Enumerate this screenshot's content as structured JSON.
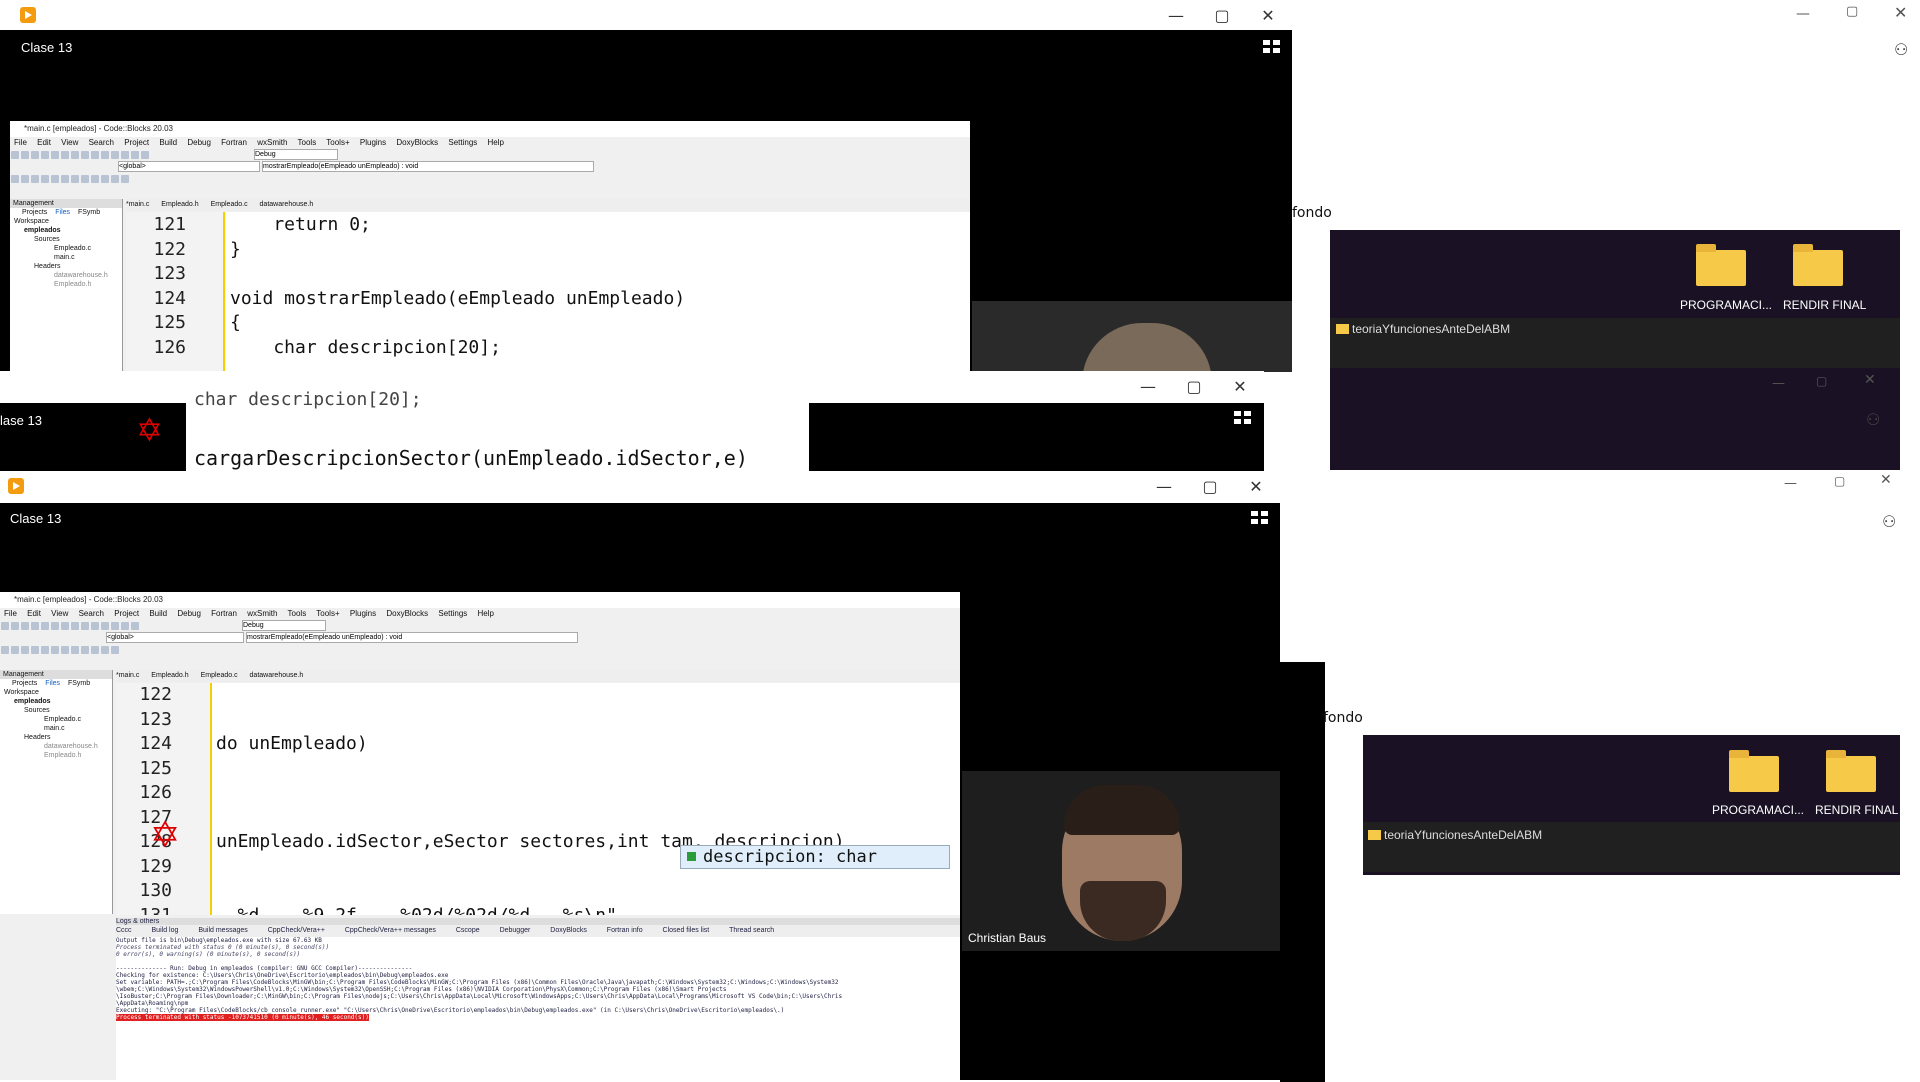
{
  "win1": {
    "title": "Clase 13"
  },
  "win2": {
    "title": "lase 13"
  },
  "win3": {
    "title": "Clase 13"
  },
  "codeblocks_top": {
    "title": "*main.c [empleados] - Code::Blocks 20.03",
    "menu": [
      "File",
      "Edit",
      "View",
      "Search",
      "Project",
      "Build",
      "Debug",
      "Fortran",
      "wxSmith",
      "Tools",
      "Tools+",
      "Plugins",
      "DoxyBlocks",
      "Settings",
      "Help"
    ],
    "build_target": "Debug",
    "scope": "<global>",
    "symbol": "mostrarEmpleado(eEmpleado unEmpleado) : void",
    "tabs": [
      "*main.c",
      "Empleado.h",
      "Empleado.c",
      "datawarehouse.h"
    ],
    "management": "Management",
    "mgmt_tabs": [
      "Projects",
      "Files",
      "FSymb"
    ],
    "tree": [
      "Workspace",
      "empleados",
      "Sources",
      "Empleado.c",
      "main.c",
      "Headers",
      "datawarehouse.h",
      "Empleado.h"
    ],
    "lines": [
      {
        "n": "121",
        "code": "    return 0;"
      },
      {
        "n": "122",
        "code": "}"
      },
      {
        "n": "123",
        "code": ""
      },
      {
        "n": "124",
        "code": "void mostrarEmpleado(eEmpleado unEmpleado)"
      },
      {
        "n": "125",
        "code": "{"
      },
      {
        "n": "126",
        "code": "    char descripcion[20];"
      }
    ]
  },
  "zoom_strip": {
    "top_text": "char descripcion[20];",
    "code_text": "cargarDescripcionSector(unEmpleado.idSector,e)"
  },
  "codeblocks_bottom": {
    "title": "*main.c [empleados] - Code::Blocks 20.03",
    "menu": [
      "File",
      "Edit",
      "View",
      "Search",
      "Project",
      "Build",
      "Debug",
      "Fortran",
      "wxSmith",
      "Tools",
      "Tools+",
      "Plugins",
      "DoxyBlocks",
      "Settings",
      "Help"
    ],
    "build_target": "Debug",
    "scope": "<global>",
    "symbol": "mostrarEmpleado(eEmpleado unEmpleado) : void",
    "tabs": [
      "*main.c",
      "Empleado.h",
      "Empleado.c",
      "datawarehouse.h"
    ],
    "management": "Management",
    "mgmt_tabs": [
      "Projects",
      "Files",
      "FSymb"
    ],
    "tree": [
      "Workspace",
      "empleados",
      "Sources",
      "Empleado.c",
      "main.c",
      "Headers",
      "datawarehouse.h",
      "Empleado.h"
    ],
    "lines": [
      {
        "n": "122",
        "code": ""
      },
      {
        "n": "123",
        "code": ""
      },
      {
        "n": "124",
        "code": "do unEmpleado)"
      },
      {
        "n": "125",
        "code": ""
      },
      {
        "n": "126",
        "code": ""
      },
      {
        "n": "127",
        "code": ""
      },
      {
        "n": "128",
        "code": "unEmpleado.idSector,eSector sectores,int tam, descripcion)"
      },
      {
        "n": "129",
        "code": ""
      },
      {
        "n": "130",
        "code": ""
      },
      {
        "n": "131",
        "code": "  %d    %9.2f    %02d/%02d/%d   %s\\n\""
      }
    ],
    "autocomplete": "descripcion: char",
    "logs_title": "Logs & others",
    "log_tabs": [
      "Cccc",
      "Build log",
      "Build messages",
      "CppCheck/Vera++",
      "CppCheck/Vera++ messages",
      "Cscope",
      "Debugger",
      "DoxyBlocks",
      "Fortran info",
      "Closed files list",
      "Thread search"
    ],
    "log_lines": [
      "Output file is bin\\Debug\\empleados.exe with size 67.63 KB",
      "Process terminated with status 0 (0 minute(s), 0 second(s))",
      "0 error(s), 0 warning(s) (0 minute(s), 0 second(s))",
      "",
      "-------------- Run: Debug in empleados (compiler: GNU GCC Compiler)---------------",
      "Checking for existence: C:\\Users\\Chris\\OneDrive\\Escritorio\\empleados\\bin\\Debug\\empleados.exe",
      "Set variable: PATH=.;C:\\Program Files\\CodeBlocks\\MinGW\\bin;C:\\Program Files\\CodeBlocks\\MinGW;C:\\Program Files (x86)\\Common Files\\Oracle\\Java\\javapath;C:\\Windows\\System32;C:\\Windows;C:\\Windows\\System32",
      "\\wbem;C:\\Windows\\System32\\WindowsPowerShell\\v1.0;C:\\Windows\\System32\\OpenSSH;C:\\Program Files (x86)\\NVIDIA Corporation\\PhysX\\Common;C:\\Program Files (x86)\\Smart Projects",
      "\\IsoBuster;C:\\Program Files\\Downloader;C:\\MinGW\\bin;C:\\Program Files\\nodejs;C:\\Users\\Chris\\AppData\\Local\\Microsoft\\WindowsApps;C:\\Users\\Chris\\AppData\\Local\\Programs\\Microsoft VS Code\\bin;C:\\Users\\Chris",
      "\\AppData\\Roaming\\npm",
      "Executing: \"C:\\Program Files\\CodeBlocks/cb_console_runner.exe\" \"C:\\Users\\Chris\\OneDrive\\Escritorio\\empleados\\bin\\Debug\\empleados.exe\"  (in C:\\Users\\Chris\\OneDrive\\Escritorio\\empleados\\.)"
    ],
    "log_error": "Process terminated with status -1073741510 (0 minute(s), 46 second(s))"
  },
  "webcam": {
    "name": "Christian Baus"
  },
  "background": {
    "fondo_1": "fondo",
    "fondo_2": "fondo",
    "folders": [
      "PROGRAMACI...",
      "RENDIR FINAL"
    ],
    "explorer_title": "teoriaYfuncionesAnteDelABM"
  }
}
